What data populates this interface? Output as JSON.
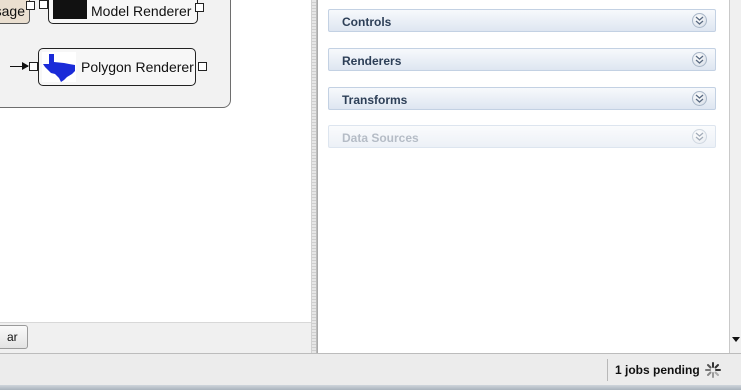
{
  "canvas": {
    "partial_node_label": "sage",
    "model_node_label": "Model Renderer",
    "polygon_node_label": "Polygon Renderer"
  },
  "left_pane": {
    "sidebar_button_label": "ar"
  },
  "right_panel": {
    "sections": [
      {
        "label": "Controls",
        "enabled": true
      },
      {
        "label": "Renderers",
        "enabled": true
      },
      {
        "label": "Transforms",
        "enabled": true
      },
      {
        "label": "Data Sources",
        "enabled": false
      }
    ],
    "accent_color": "#dee6f1",
    "header_text_color": "#2d3f57"
  },
  "status_bar": {
    "jobs_pending": "1 jobs pending",
    "spinner_icon": "spinner-icon"
  },
  "polygon_thumbnail_color": "#1a2bd8"
}
